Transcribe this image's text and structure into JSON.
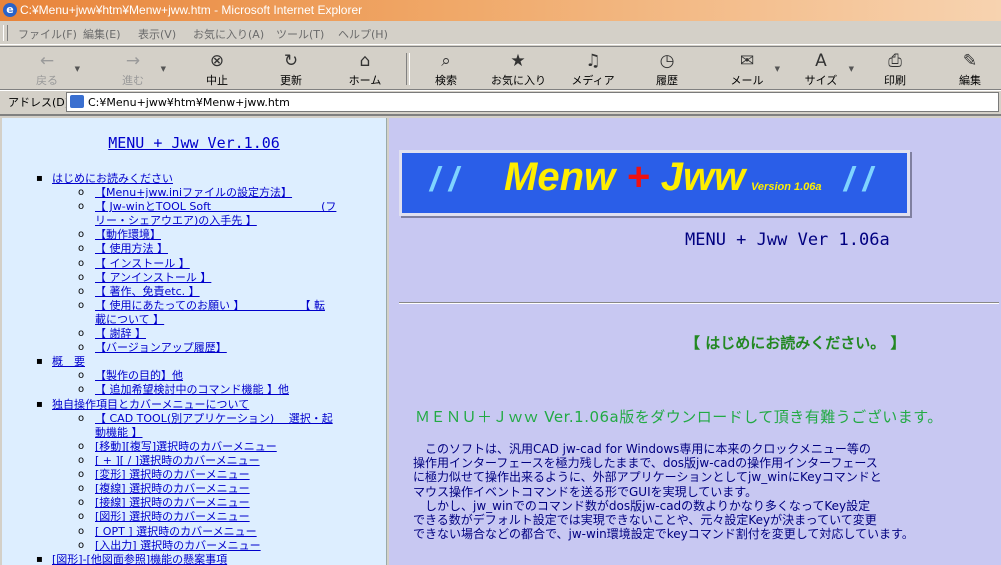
{
  "window": {
    "title": "C:¥Menu+jww¥htm¥Menw+jww.htm - Microsoft Internet Explorer"
  },
  "menu": [
    "ファイル(F)",
    "編集(E)",
    "表示(V)",
    "お気に入り(A)",
    "ツール(T)",
    "ヘルプ(H)"
  ],
  "toolbar": {
    "back": "戻る",
    "forward": "進む",
    "stop": "中止",
    "refresh": "更新",
    "home": "ホーム",
    "search": "検索",
    "favorites": "お気に入り",
    "media": "メディア",
    "history": "履歴",
    "mail": "メール",
    "size": "サイズ",
    "print": "印刷",
    "edit": "編集"
  },
  "address": {
    "label": "アドレス(D)",
    "url": "C:¥Menu+jww¥htm¥Menw+jww.htm"
  },
  "left": {
    "title": "MENU + Jww Ver.1.06",
    "items": [
      {
        "level": 1,
        "text": "はじめにお読みください"
      },
      {
        "level": 2,
        "text": "【Menu+jww.iniファイルの設定方法】"
      },
      {
        "level": 2,
        "text": "【 Jw-winとTOOL Soft　　　　　　　　　　(フ"
      },
      {
        "level": 3,
        "text": "リー・シェアウエア)の入手先 】"
      },
      {
        "level": 2,
        "text": "【動作環境】"
      },
      {
        "level": 2,
        "text": "【 使用方法 】"
      },
      {
        "level": 2,
        "text": "【 インストール 】"
      },
      {
        "level": 2,
        "text": "【 アンインストール 】"
      },
      {
        "level": 2,
        "text": "【 著作、免責etc. 】"
      },
      {
        "level": 2,
        "text": "【 使用にあたってのお願い 】　　　　　　【 転"
      },
      {
        "level": 3,
        "text": "載について 】"
      },
      {
        "level": 2,
        "text": "【 謝辞 】"
      },
      {
        "level": 2,
        "text": "【バージョンアップ履歴】"
      },
      {
        "level": 1,
        "text": "概　要"
      },
      {
        "level": 2,
        "text": "【製作の目的】他"
      },
      {
        "level": 2,
        "text": "【 追加希望検討中のコマンド機能 】他"
      },
      {
        "level": 1,
        "text": "独自操作項目とカバーメニューについて"
      },
      {
        "level": 2,
        "text": "【 CAD TOOL(別アプリケーション)　 選択・起"
      },
      {
        "level": 3,
        "text": "動機能 】"
      },
      {
        "level": 2,
        "text": "[移動][複写]選択時のカバーメニュー"
      },
      {
        "level": 2,
        "text": "[ + ][ / ]選択時のカバーメニュー"
      },
      {
        "level": 2,
        "text": "[変形] 選択時のカバーメニュー"
      },
      {
        "level": 2,
        "text": "[複線] 選択時のカバーメニュー"
      },
      {
        "level": 2,
        "text": "[接線] 選択時のカバーメニュー"
      },
      {
        "level": 2,
        "text": "[図形] 選択時のカバーメニュー"
      },
      {
        "level": 2,
        "text": "[ OPT ] 選択時のカバーメニュー"
      },
      {
        "level": 2,
        "text": "[入出力] 選択時のカバーメニュー"
      },
      {
        "level": 1,
        "text": "[図形]-[他図面参照]機能の懸案事項"
      }
    ]
  },
  "right": {
    "banner_slash_l": "/ /",
    "banner_menw": "Menw",
    "banner_plus": "+",
    "banner_jww": "Jww",
    "banner_version": "Version 1.06a",
    "banner_slash_r": "/ /",
    "subtitle": "MENU + Jww Ver 1.06a",
    "readme": "【 はじめにお読みください。 】",
    "greeting": "ＭＥＮＵ＋Ｊｗｗ Ver.1.06a版をダウンロードして頂き有難うございます。",
    "body": "　このソフトは、汎用CAD jw-cad for Windows専用に本来のクロックメニュー等の\n操作用インターフェースを極力残したままで、dos版jw-cadの操作用インターフェース\nに極力似せて操作出来るように、外部アプリケーションとしてjw_winにKeyコマンドと\nマウス操作イベントコマンドを送る形でGUIを実現しています。\n　しかし、jw_winでのコマンド数がdos版jw-cadの数よりかなり多くなってKey設定\nできる数がデフォルト設定では実現できないことや、元々設定Keyが決まっていて変更\nできない場合などの都合で、jw-win環境設定でkeyコマンド割付を変更して対応しています。"
  }
}
